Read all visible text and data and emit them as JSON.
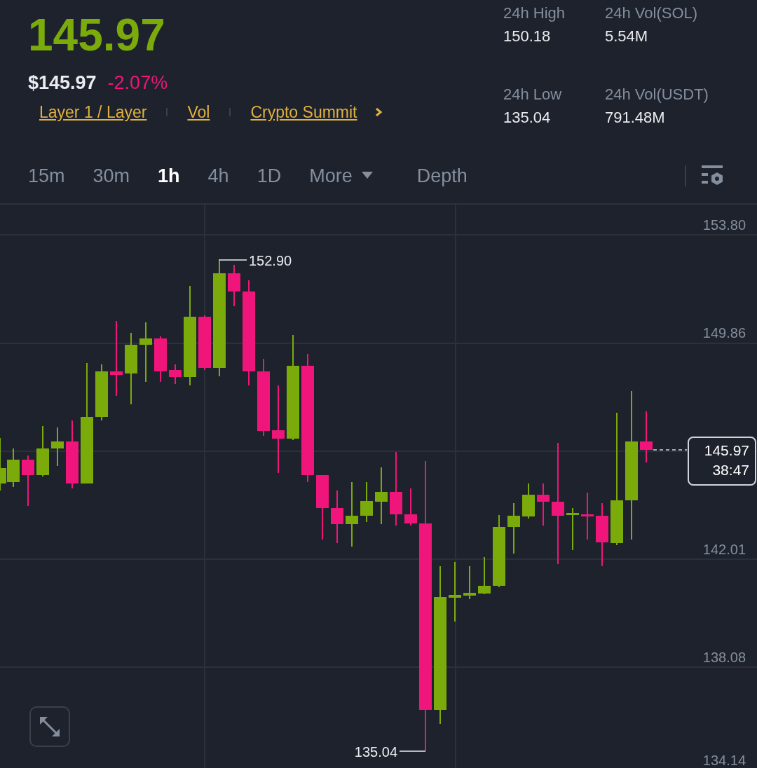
{
  "header": {
    "last_price": "145.97",
    "usd_price": "$145.97",
    "change": "-2.07%",
    "tags": [
      {
        "label": "Layer 1 / Layer"
      },
      {
        "label": "Vol"
      },
      {
        "label": "Crypto Summit"
      }
    ]
  },
  "stats": [
    {
      "label": "24h High",
      "value": "150.18"
    },
    {
      "label": "24h Vol(SOL)",
      "value": "5.54M"
    },
    {
      "label": "24h Low",
      "value": "135.04"
    },
    {
      "label": "24h Vol(USDT)",
      "value": "791.48M"
    }
  ],
  "tabs": [
    {
      "label": "15m",
      "kind": "interval",
      "selected": false
    },
    {
      "label": "30m",
      "kind": "interval",
      "selected": false
    },
    {
      "label": "1h",
      "kind": "interval",
      "selected": true
    },
    {
      "label": "4h",
      "kind": "interval",
      "selected": false
    },
    {
      "label": "1D",
      "kind": "interval",
      "selected": false
    },
    {
      "label": "More",
      "kind": "menu",
      "selected": false
    },
    {
      "label": "Depth",
      "kind": "view",
      "selected": false
    }
  ],
  "chart": {
    "price_axis": [
      "153.80",
      "149.86",
      "142.01",
      "138.08",
      "134.14"
    ],
    "high_marker": "152.90",
    "low_marker": "135.04",
    "current_price": "145.97",
    "countdown": "38:47"
  }
}
